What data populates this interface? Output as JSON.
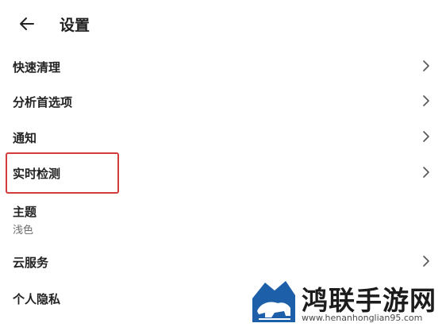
{
  "header": {
    "title": "设置",
    "back_icon": "arrow-left-icon"
  },
  "settings": {
    "items": [
      {
        "label": "快速清理",
        "icon": "chevron-right-icon"
      },
      {
        "label": "分析首选项",
        "icon": "chevron-right-icon"
      },
      {
        "label": "通知",
        "icon": "chevron-right-icon"
      },
      {
        "label": "实时检测",
        "icon": "chevron-right-icon",
        "highlighted": true
      },
      {
        "label": "主题",
        "value": "浅色"
      },
      {
        "label": "云服务",
        "icon": "chevron-right-icon"
      },
      {
        "label": "个人隐私"
      }
    ]
  },
  "watermark": {
    "brand": "鸿联手游网",
    "url": "www.henanhonglian95.com"
  },
  "colors": {
    "highlight_border": "#d43b3b",
    "text_primary": "#232323",
    "text_secondary": "#6b6b6b",
    "logo_blue": "#1d5fa8"
  }
}
